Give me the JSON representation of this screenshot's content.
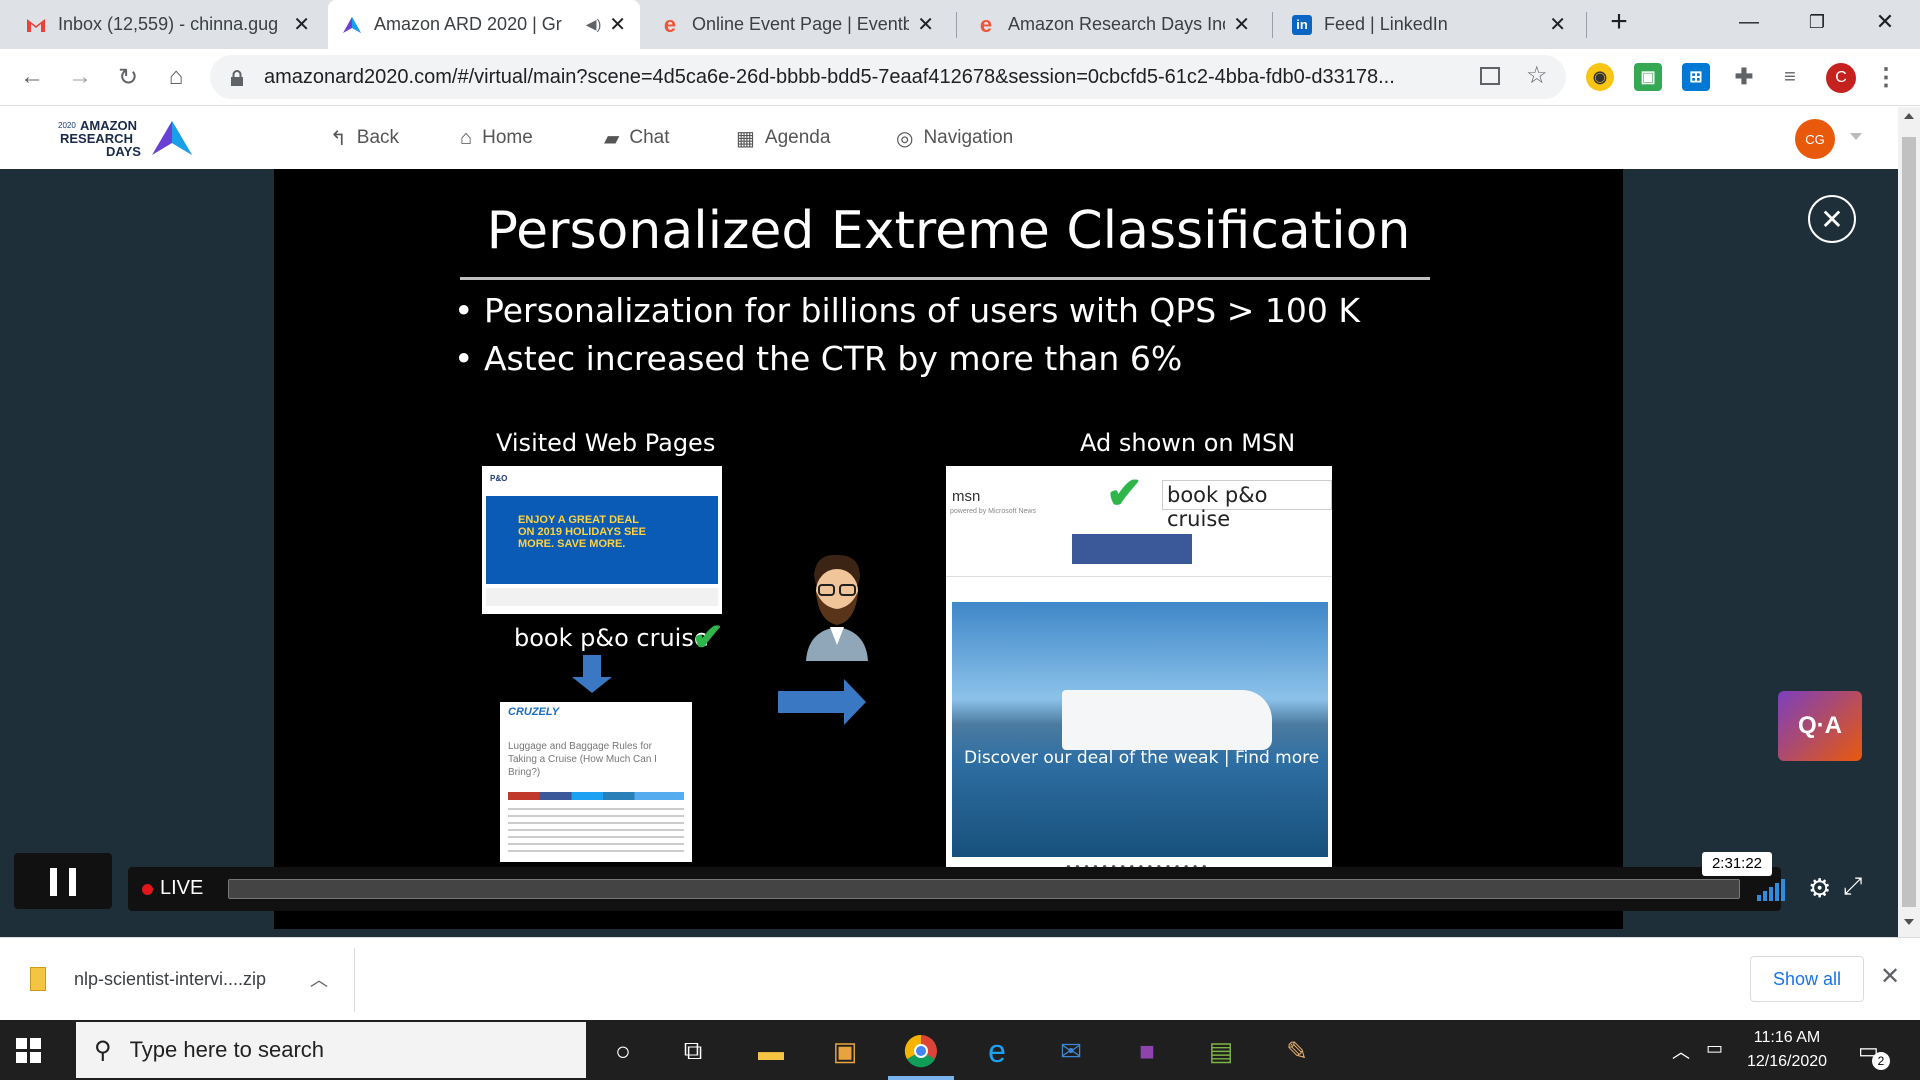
{
  "browser": {
    "tabs": [
      {
        "title": "Inbox (12,559) - chinna.gug",
        "icon": "gmail-icon",
        "active": false
      },
      {
        "title": "Amazon ARD 2020 | Gr",
        "icon": "amazon-ard-icon",
        "active": true,
        "audio": true
      },
      {
        "title": "Online Event Page | Eventbr",
        "icon": "eventbrite-icon",
        "active": false
      },
      {
        "title": "Amazon Research Days Ind",
        "icon": "eventbrite-icon",
        "active": false
      },
      {
        "title": "Feed | LinkedIn",
        "icon": "linkedin-icon",
        "active": false
      }
    ],
    "url": "amazonard2020.com/#/virtual/main?scene=4d5ca6e-26d-bbbb-bdd5-7eaaf412678&session=0cbcfd5-61c2-4bba-fdb0-d33178...",
    "profile_initial": "C"
  },
  "site": {
    "brand": {
      "year": "2020",
      "line1": "AMAZON",
      "line2": "RESEARCH",
      "line3": "DAYS"
    },
    "nav": [
      {
        "label": "Back",
        "icon": "back-icon"
      },
      {
        "label": "Home",
        "icon": "home-icon"
      },
      {
        "label": "Chat",
        "icon": "chat-icon"
      },
      {
        "label": "Agenda",
        "icon": "calendar-icon"
      },
      {
        "label": "Navigation",
        "icon": "compass-icon"
      }
    ],
    "avatar": "CG"
  },
  "slide": {
    "title": "Personalized Extreme Classification",
    "bullets": [
      "Personalization for billions of users with QPS > 100 K",
      "Astec increased the CTR by more than 6%"
    ],
    "left_label": "Visited Web Pages",
    "right_label": "Ad shown on MSN",
    "query_text": "book p&o cruise",
    "msn_query": "book p&o cruise",
    "po_banner": "ENJOY A GREAT DEAL ON 2019 HOLIDAYS SEE MORE. SAVE MORE.",
    "cruzely_title": "Luggage and Baggage Rules for Taking a Cruise (How Much Can I Bring?)",
    "ad_caption": "Discover our deal of the weak | Find more"
  },
  "player": {
    "live_label": "LIVE",
    "time": "2:31:22",
    "qa_label": "Q·A"
  },
  "downloads": {
    "file": "nlp-scientist-intervi....zip",
    "show_all": "Show all"
  },
  "taskbar": {
    "search_placeholder": "Type here to search",
    "time": "11:16 AM",
    "date": "12/16/2020",
    "notifications": "2"
  }
}
